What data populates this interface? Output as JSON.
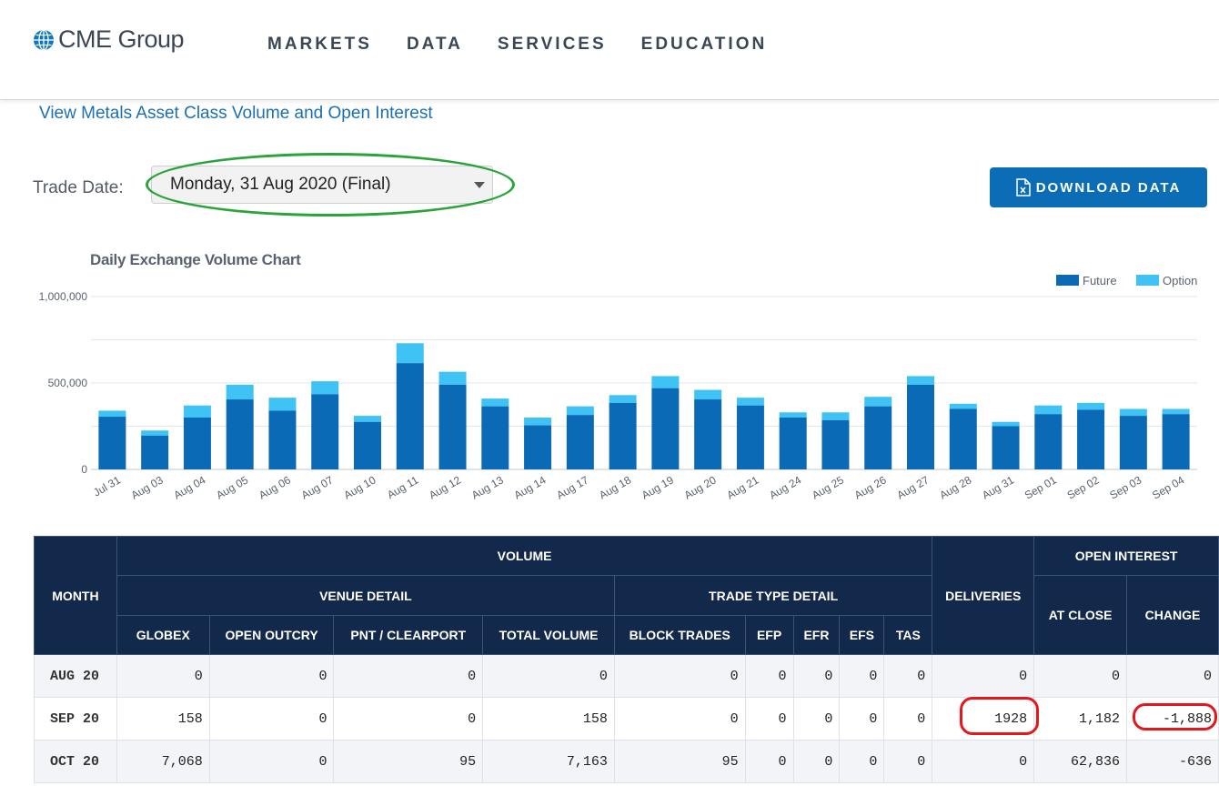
{
  "header": {
    "logo_text": "CME Group",
    "nav": [
      "MARKETS",
      "DATA",
      "SERVICES",
      "EDUCATION"
    ]
  },
  "view_link": "View Metals Asset Class Volume and Open Interest",
  "trade_date": {
    "label": "Trade Date:",
    "selected": "Monday, 31 Aug 2020 (Final)"
  },
  "download_label": "DOWNLOAD DATA",
  "chart_data": {
    "type": "bar",
    "title": "Daily Exchange Volume Chart",
    "stacked": true,
    "categories": [
      "Jul 31",
      "Aug 03",
      "Aug 04",
      "Aug 05",
      "Aug 06",
      "Aug 07",
      "Aug 10",
      "Aug 11",
      "Aug 12",
      "Aug 13",
      "Aug 14",
      "Aug 17",
      "Aug 18",
      "Aug 19",
      "Aug 20",
      "Aug 21",
      "Aug 24",
      "Aug 25",
      "Aug 26",
      "Aug 27",
      "Aug 28",
      "Aug 31",
      "Sep 01",
      "Sep 02",
      "Sep 03",
      "Sep 04"
    ],
    "series": [
      {
        "name": "Future",
        "color": "#0a6ab6",
        "values": [
          305000,
          195000,
          300000,
          405000,
          340000,
          435000,
          275000,
          615000,
          490000,
          365000,
          255000,
          315000,
          385000,
          470000,
          405000,
          370000,
          300000,
          285000,
          365000,
          490000,
          350000,
          250000,
          320000,
          345000,
          310000,
          320000
        ]
      },
      {
        "name": "Option",
        "color": "#3fc3f5",
        "values": [
          35000,
          30000,
          70000,
          85000,
          75000,
          75000,
          35000,
          115000,
          75000,
          45000,
          45000,
          50000,
          45000,
          70000,
          55000,
          45000,
          30000,
          45000,
          55000,
          50000,
          30000,
          25000,
          50000,
          40000,
          40000,
          30000
        ]
      }
    ],
    "ylim": [
      0,
      1000000
    ],
    "yticks": [
      "0",
      "500,000",
      "1,000,000"
    ],
    "legend_position": "top-right",
    "grid": true
  },
  "table": {
    "headers": {
      "month": "MONTH",
      "volume": "VOLUME",
      "venue_detail": "VENUE DETAIL",
      "trade_type_detail": "TRADE TYPE DETAIL",
      "deliveries": "DELIVERIES",
      "open_interest": "OPEN INTEREST",
      "globex": "GLOBEX",
      "open_outcry": "OPEN OUTCRY",
      "pnt_clearport": "PNT / CLEARPORT",
      "total_volume": "TOTAL VOLUME",
      "block_trades": "BLOCK TRADES",
      "efp": "EFP",
      "efr": "EFR",
      "efs": "EFS",
      "tas": "TAS",
      "at_close": "AT CLOSE",
      "change": "CHANGE"
    },
    "rows": [
      {
        "month": "AUG 20",
        "globex": "0",
        "open_outcry": "0",
        "pnt": "0",
        "total": "0",
        "block": "0",
        "efp": "0",
        "efr": "0",
        "efs": "0",
        "tas": "0",
        "deliveries": "0",
        "at_close": "0",
        "change": "0"
      },
      {
        "month": "SEP 20",
        "globex": "158",
        "open_outcry": "0",
        "pnt": "0",
        "total": "158",
        "block": "0",
        "efp": "0",
        "efr": "0",
        "efs": "0",
        "tas": "0",
        "deliveries": "1928",
        "at_close": "1,182",
        "change": "-1,888"
      },
      {
        "month": "OCT 20",
        "globex": "7,068",
        "open_outcry": "0",
        "pnt": "95",
        "total": "7,163",
        "block": "95",
        "efp": "0",
        "efr": "0",
        "efs": "0",
        "tas": "0",
        "deliveries": "0",
        "at_close": "62,836",
        "change": "-636"
      }
    ]
  }
}
